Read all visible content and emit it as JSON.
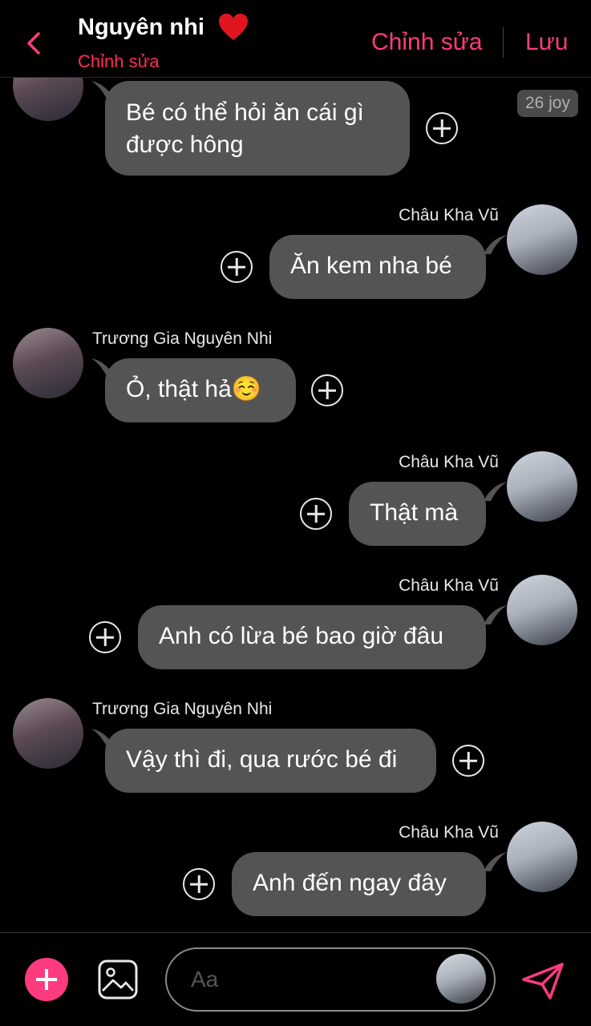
{
  "header": {
    "contact_name": "Nguyên nhi",
    "subtitle": "Chỉnh sửa",
    "edit_label": "Chỉnh sửa",
    "save_label": "Lưu",
    "accent_color": "#ff3b7f"
  },
  "top_badge": "26 joy",
  "messages": [
    {
      "side": "left",
      "sender": "",
      "text": "Bé có thể hỏi ăn cái gì được hông"
    },
    {
      "side": "right",
      "sender": "Châu Kha Vũ",
      "text": "Ăn kem nha bé"
    },
    {
      "side": "left",
      "sender": "Trương Gia Nguyên Nhi",
      "text": "Ỏ, thật hả☺️"
    },
    {
      "side": "right",
      "sender": "Châu Kha Vũ",
      "text": "Thật mà"
    },
    {
      "side": "right",
      "sender": "Châu Kha Vũ",
      "text": "Anh có lừa bé bao giờ đâu"
    },
    {
      "side": "left",
      "sender": "Trương Gia Nguyên Nhi",
      "text": "Vậy thì đi, qua rước bé đi"
    },
    {
      "side": "right",
      "sender": "Châu Kha Vũ",
      "text": "Anh đến ngay đây"
    }
  ],
  "composer": {
    "placeholder": "Aa"
  },
  "icons": {
    "back": "chevron-left-icon",
    "heart": "heart-icon",
    "add": "plus-icon",
    "image": "image-icon",
    "send": "send-icon"
  }
}
